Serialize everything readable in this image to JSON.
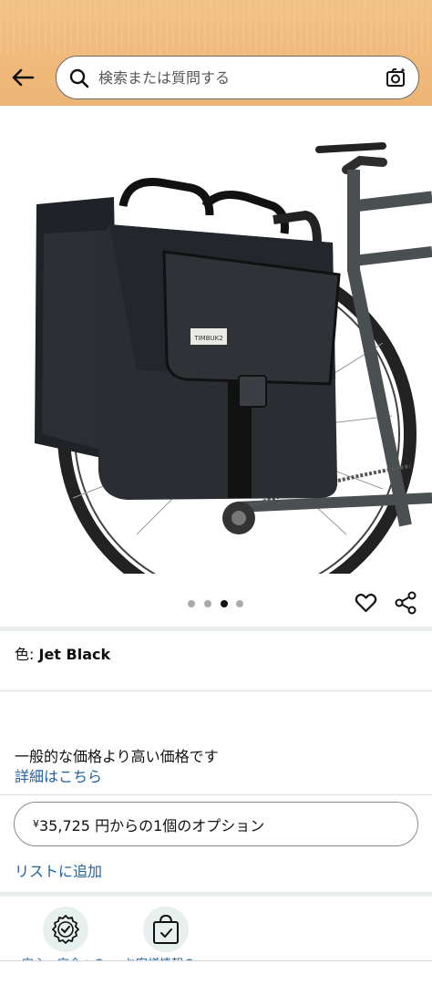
{
  "header": {
    "search_placeholder": "検索または質問する",
    "back_icon": "arrow-left-icon",
    "search_icon": "magnifier-icon",
    "camera_icon": "camera-sparkle-icon"
  },
  "gallery": {
    "image_description_icon": "product-image",
    "brand_label_on_bag": "TIMBUK2",
    "total_images": 4,
    "active_index": 2
  },
  "actions": {
    "wishlist_icon": "heart-icon",
    "share_icon": "share-icon"
  },
  "variation": {
    "label": "色:",
    "value": "Jet Black"
  },
  "pricing": {
    "note": "一般的な価格より高い価格です",
    "details_link": "詳細はこちら"
  },
  "options": {
    "currency_symbol": "¥",
    "button_label": "35,725 円からの1個のオプション"
  },
  "list": {
    "add_label": "リストに追加"
  },
  "badges": [
    {
      "icon": "shield-check-icon",
      "label": "安心・安全への"
    },
    {
      "icon": "shopping-bag-check-icon",
      "label": "お客様情報の"
    }
  ],
  "colors": {
    "header_bg": "#efb97a",
    "link": "#2162a1",
    "badge_bg": "#e6f1ef",
    "dot_active": "#111111",
    "dot_inactive": "#aaaaaa"
  }
}
